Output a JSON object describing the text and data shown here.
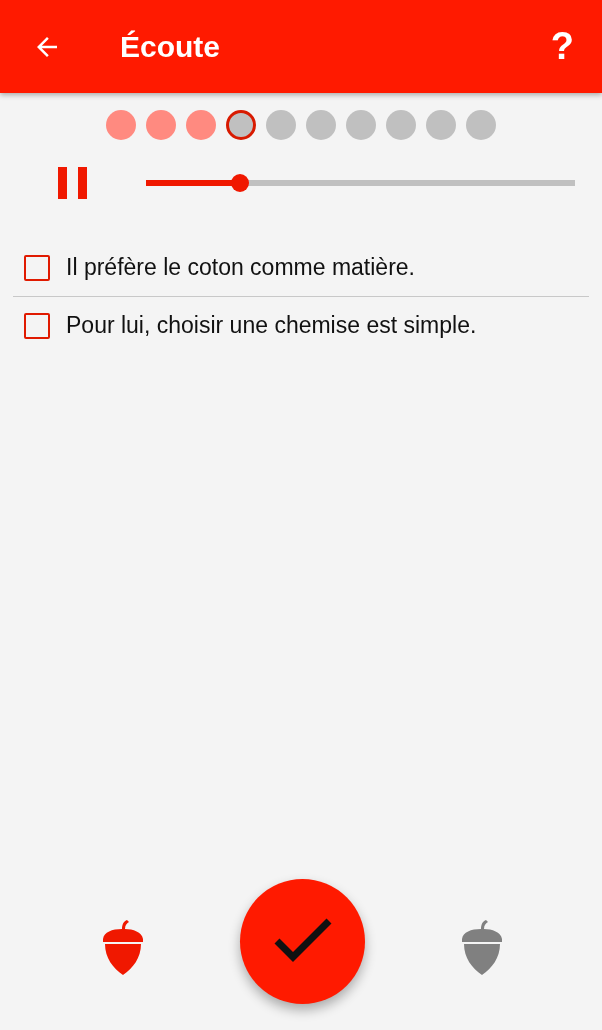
{
  "app_bar": {
    "title": "Écoute",
    "help": "?"
  },
  "progress": [
    {
      "done": true,
      "selected": false
    },
    {
      "done": true,
      "selected": false
    },
    {
      "done": true,
      "selected": false
    },
    {
      "done": false,
      "selected": true
    },
    {
      "done": false,
      "selected": false
    },
    {
      "done": false,
      "selected": false
    },
    {
      "done": false,
      "selected": false
    },
    {
      "done": false,
      "selected": false
    },
    {
      "done": false,
      "selected": false
    },
    {
      "done": false,
      "selected": false
    }
  ],
  "player": {
    "playing": true,
    "level": 0.22
  },
  "options": [
    {
      "text": "Il préfère le coton comme matière.",
      "checked": false
    },
    {
      "text": "Pour lui, choisir une chemise est simple.",
      "checked": false
    }
  ],
  "acorns": [
    {
      "filled": true
    },
    {
      "filled": false
    }
  ]
}
